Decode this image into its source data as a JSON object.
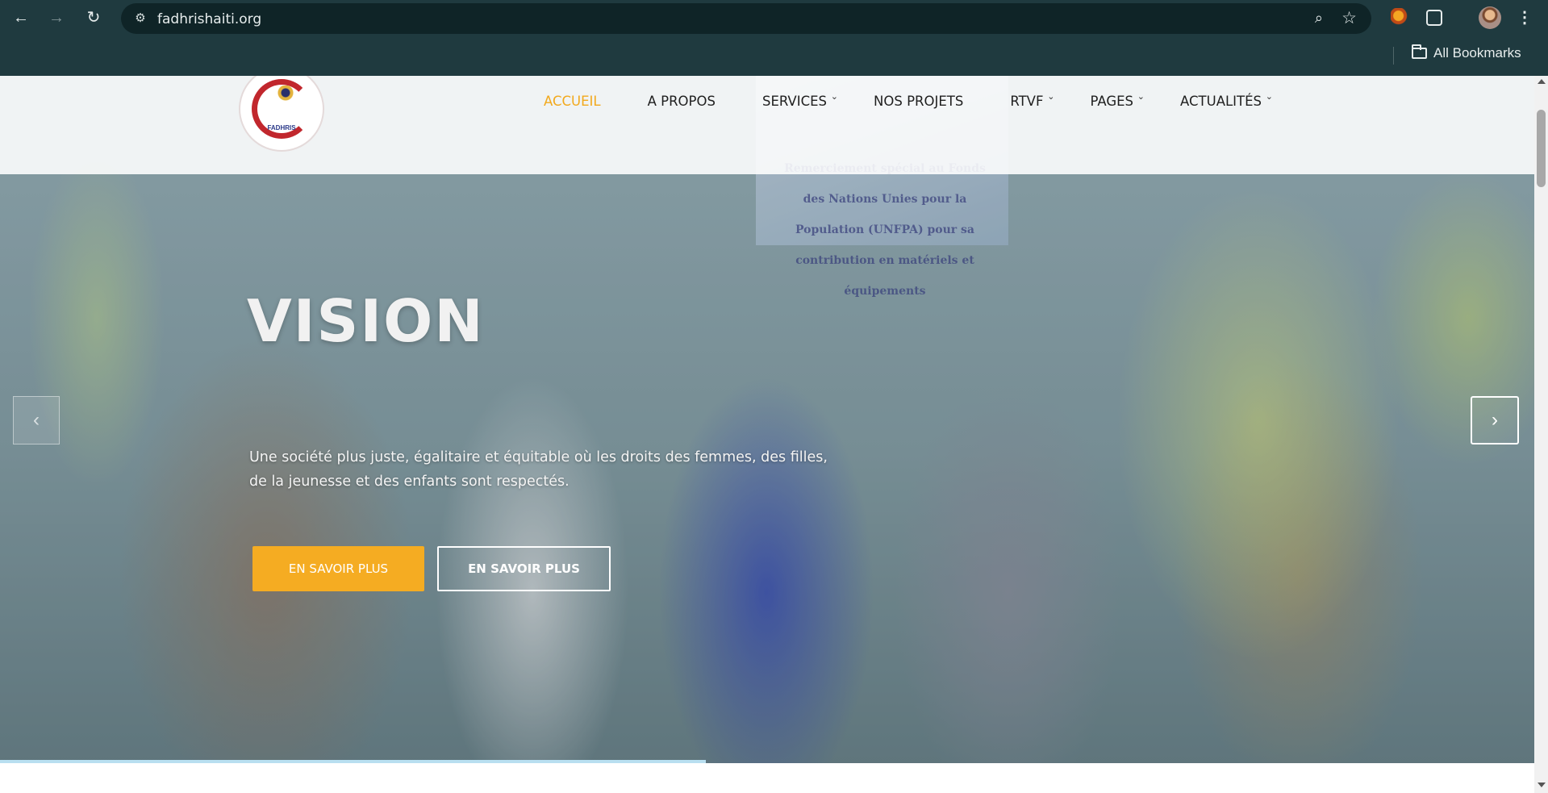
{
  "browser": {
    "url": "fadhrishaiti.org",
    "bookmarks_label": "All Bookmarks",
    "icons": [
      "back-icon",
      "forward-icon",
      "reload-icon",
      "site-info-icon",
      "zoom-icon",
      "star-icon",
      "extension-icon",
      "puzzle-icon",
      "profile-avatar",
      "more-menu-icon",
      "folder-icon"
    ]
  },
  "site": {
    "logo_text": "FADHRIS",
    "nav": [
      {
        "label": "ACCUEIL",
        "active": true,
        "dropdown": false
      },
      {
        "label": "A PROPOS",
        "active": false,
        "dropdown": false
      },
      {
        "label": "SERVICES",
        "active": false,
        "dropdown": true
      },
      {
        "label": "NOS PROJETS",
        "active": false,
        "dropdown": false
      },
      {
        "label": "RTVF",
        "active": false,
        "dropdown": true
      },
      {
        "label": "PAGES",
        "active": false,
        "dropdown": true
      },
      {
        "label": "ACTUALITÉS",
        "active": false,
        "dropdown": true
      }
    ],
    "accent_color": "#f5ac22"
  },
  "hero": {
    "poster_text": "Remerciement spécial au Fonds des Nations Unies pour la Population (UNFPA) pour sa contribution en matériels et équipements",
    "title": "VISION",
    "description": "Une société plus juste, égalitaire et équitable où les droits des femmes, des filles, de la jeunesse et des enfants sont respectés.",
    "primary_button": "EN SAVOIR PLUS",
    "secondary_button": "EN SAVOIR PLUS",
    "prev_arrow": "‹",
    "next_arrow": "›",
    "slide_progress": 0.46
  }
}
